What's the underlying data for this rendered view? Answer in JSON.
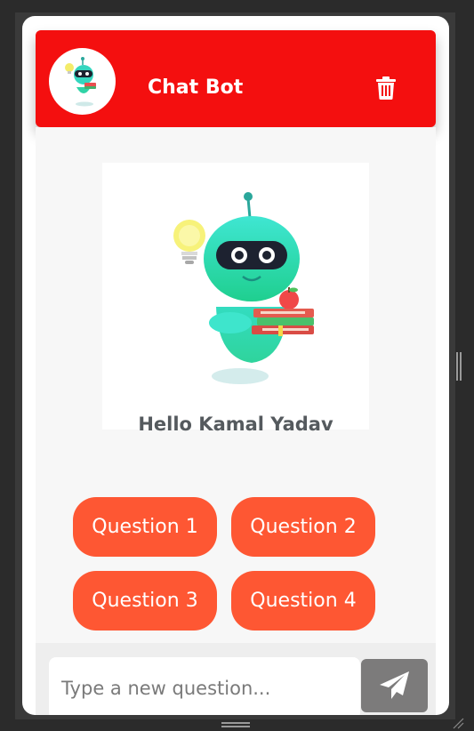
{
  "header": {
    "title": "Chat Bot",
    "avatar_icon": "robot-avatar-icon",
    "clear_icon": "trash-icon",
    "background": "#f40f0f"
  },
  "welcome": {
    "illustration": "robot-with-books-and-lightbulb",
    "greeting": "Hello Kamal Yadav"
  },
  "questions": [
    {
      "label": "Question 1"
    },
    {
      "label": "Question 2"
    },
    {
      "label": "Question 3"
    },
    {
      "label": "Question 4"
    }
  ],
  "question_color": "#fe5733",
  "composer": {
    "placeholder": "Type a new question...",
    "value": "",
    "send_icon": "paper-plane-icon",
    "send_background": "#7c7b7b"
  }
}
